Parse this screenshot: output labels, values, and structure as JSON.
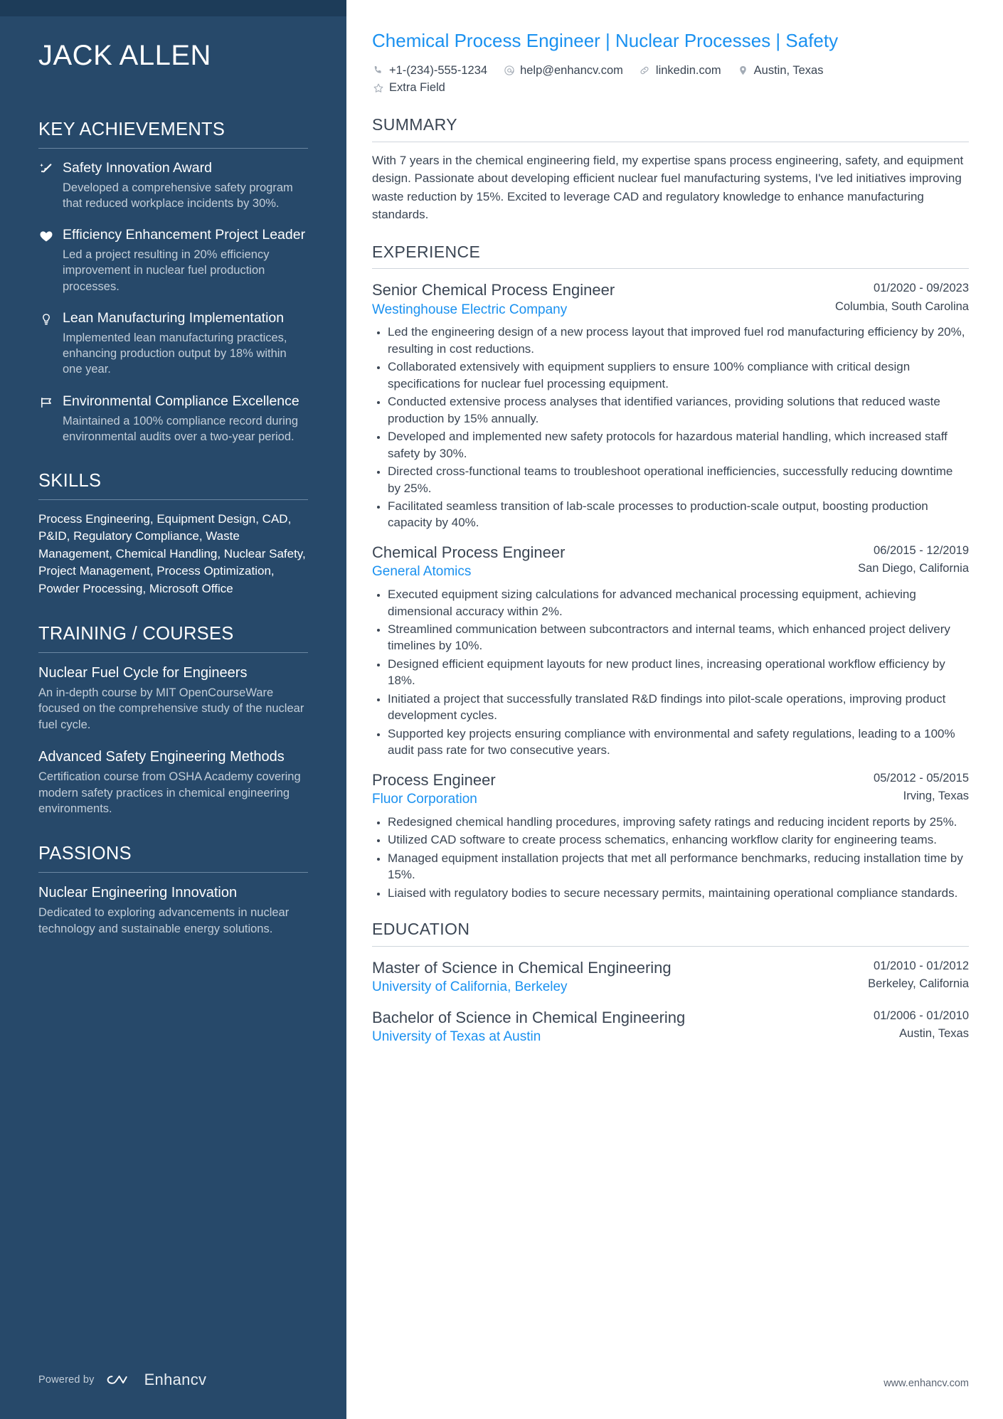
{
  "sidebar": {
    "name": "JACK ALLEN",
    "sections": {
      "achievements": {
        "title": "KEY ACHIEVEMENTS",
        "items": [
          {
            "icon": "sparkle-icon",
            "title": "Safety Innovation Award",
            "description": "Developed a comprehensive safety program that reduced workplace incidents by 30%."
          },
          {
            "icon": "heart-icon",
            "title": "Efficiency Enhancement Project Leader",
            "description": "Led a project resulting in 20% efficiency improvement in nuclear fuel production processes."
          },
          {
            "icon": "lightbulb-icon",
            "title": "Lean Manufacturing Implementation",
            "description": "Implemented lean manufacturing practices, enhancing production output by 18% within one year."
          },
          {
            "icon": "flag-icon",
            "title": "Environmental Compliance Excellence",
            "description": "Maintained a 100% compliance record during environmental audits over a two-year period."
          }
        ]
      },
      "skills": {
        "title": "SKILLS",
        "text": "Process Engineering, Equipment Design, CAD, P&ID, Regulatory Compliance, Waste Management, Chemical Handling, Nuclear Safety, Project Management, Process Optimization, Powder Processing, Microsoft Office"
      },
      "training": {
        "title": "TRAINING / COURSES",
        "items": [
          {
            "title": "Nuclear Fuel Cycle for Engineers",
            "description": "An in-depth course by MIT OpenCourseWare focused on the comprehensive study of the nuclear fuel cycle."
          },
          {
            "title": "Advanced Safety Engineering Methods",
            "description": "Certification course from OSHA Academy covering modern safety practices in chemical engineering environments."
          }
        ]
      },
      "passions": {
        "title": "PASSIONS",
        "items": [
          {
            "title": "Nuclear Engineering Innovation",
            "description": "Dedicated to exploring advancements in nuclear technology and sustainable energy solutions."
          }
        ]
      }
    },
    "footer": {
      "powered_by": "Powered by",
      "brand": "Enhancv"
    }
  },
  "main": {
    "headline": "Chemical Process Engineer | Nuclear Processes | Safety",
    "contact": [
      {
        "icon": "phone-icon",
        "value": "+1-(234)-555-1234"
      },
      {
        "icon": "email-icon",
        "value": "help@enhancv.com"
      },
      {
        "icon": "link-icon",
        "value": "linkedin.com"
      },
      {
        "icon": "location-pin-icon",
        "value": "Austin, Texas"
      },
      {
        "icon": "star-icon",
        "value": "Extra Field"
      }
    ],
    "summary": {
      "title": "SUMMARY",
      "text": "With 7 years in the chemical engineering field, my expertise spans process engineering, safety, and equipment design. Passionate about developing efficient nuclear fuel manufacturing systems, I've led initiatives improving waste reduction by 15%. Excited to leverage CAD and regulatory knowledge to enhance manufacturing standards."
    },
    "experience": {
      "title": "EXPERIENCE",
      "entries": [
        {
          "role": "Senior Chemical Process Engineer",
          "company": "Westinghouse Electric Company",
          "dates": "01/2020 - 09/2023",
          "location": "Columbia, South Carolina",
          "bullets": [
            "Led the engineering design of a new process layout that improved fuel rod manufacturing efficiency by 20%, resulting in cost reductions.",
            "Collaborated extensively with equipment suppliers to ensure 100% compliance with critical design specifications for nuclear fuel processing equipment.",
            "Conducted extensive process analyses that identified variances, providing solutions that reduced waste production by 15% annually.",
            "Developed and implemented new safety protocols for hazardous material handling, which increased staff safety by 30%.",
            "Directed cross-functional teams to troubleshoot operational inefficiencies, successfully reducing downtime by 25%.",
            "Facilitated seamless transition of lab-scale processes to production-scale output, boosting production capacity by 40%."
          ]
        },
        {
          "role": "Chemical Process Engineer",
          "company": "General Atomics",
          "dates": "06/2015 - 12/2019",
          "location": "San Diego, California",
          "bullets": [
            "Executed equipment sizing calculations for advanced mechanical processing equipment, achieving dimensional accuracy within 2%.",
            "Streamlined communication between subcontractors and internal teams, which enhanced project delivery timelines by 10%.",
            "Designed efficient equipment layouts for new product lines, increasing operational workflow efficiency by 18%.",
            "Initiated a project that successfully translated R&D findings into pilot-scale operations, improving product development cycles.",
            "Supported key projects ensuring compliance with environmental and safety regulations, leading to a 100% audit pass rate for two consecutive years."
          ]
        },
        {
          "role": "Process Engineer",
          "company": "Fluor Corporation",
          "dates": "05/2012 - 05/2015",
          "location": "Irving, Texas",
          "bullets": [
            "Redesigned chemical handling procedures, improving safety ratings and reducing incident reports by 25%.",
            "Utilized CAD software to create process schematics, enhancing workflow clarity for engineering teams.",
            "Managed equipment installation projects that met all performance benchmarks, reducing installation time by 15%.",
            "Liaised with regulatory bodies to secure necessary permits, maintaining operational compliance standards."
          ]
        }
      ]
    },
    "education": {
      "title": "EDUCATION",
      "entries": [
        {
          "degree": "Master of Science in Chemical Engineering",
          "school": "University of California, Berkeley",
          "dates": "01/2010 - 01/2012",
          "location": "Berkeley, California"
        },
        {
          "degree": "Bachelor of Science in Chemical Engineering",
          "school": "University of Texas at Austin",
          "dates": "01/2006 - 01/2010",
          "location": "Austin, Texas"
        }
      ]
    },
    "footer_url": "www.enhancv.com"
  },
  "colors": {
    "sidebar_bg": "#27496a",
    "sidebar_topbar": "#1d3c59",
    "accent_blue": "#1a91f0",
    "body_text": "#3a4553",
    "muted_text": "#c3ced9"
  }
}
